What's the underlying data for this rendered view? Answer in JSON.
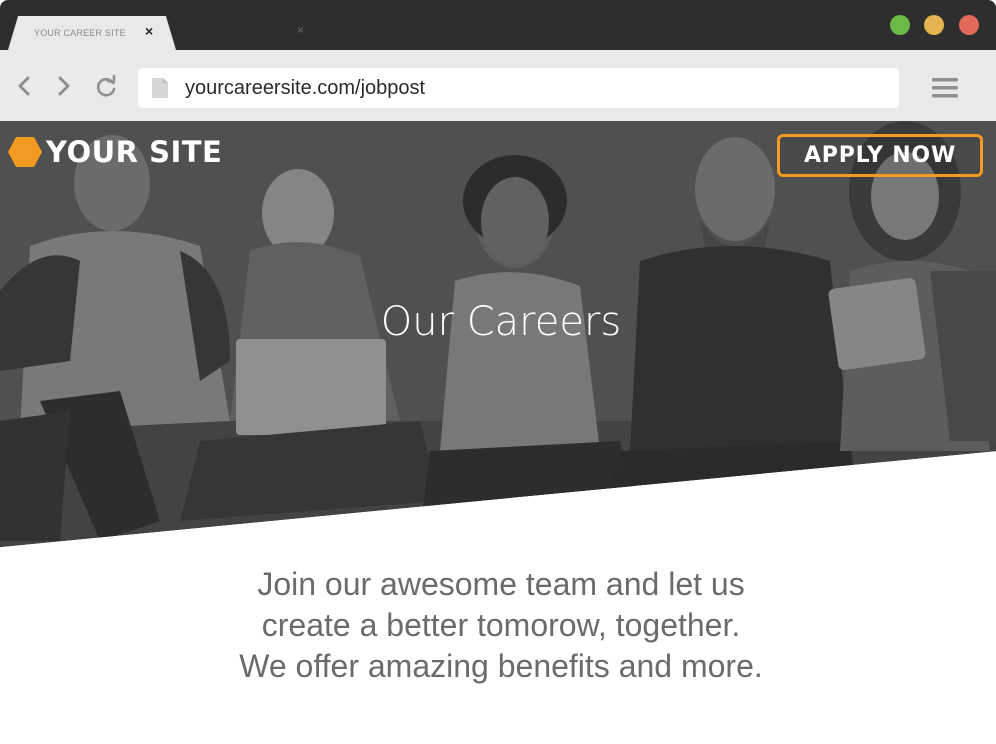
{
  "browser": {
    "tab_title": "YOUR CAREER SITE",
    "tab_close": "×",
    "new_tab_close": "×",
    "url": "yourcareersite.com/jobpost",
    "icons": [
      "back-icon",
      "forward-icon",
      "reload-icon",
      "page-icon",
      "menu-icon"
    ],
    "window_controls": {
      "green": "#6cb947",
      "yellow": "#e3b44f",
      "red": "#e26a5a"
    }
  },
  "site": {
    "brand_name": "YOUR SITE",
    "brand_color": "#f39a22",
    "apply_label": "APPLY NOW",
    "hero_title": "Our Careers",
    "body_lines": [
      "Join our awesome team and let us",
      "create a better tomorow, together.",
      "We offer amazing benefits and more."
    ]
  }
}
